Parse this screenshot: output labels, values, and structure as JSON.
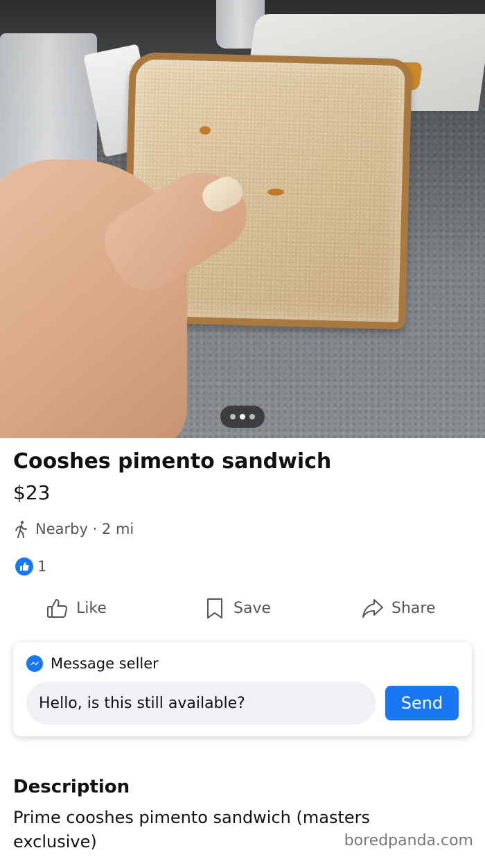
{
  "listing": {
    "title": "Cooshes pimento sandwich",
    "price": "$23",
    "location": "Nearby · 2 mi",
    "like_count": "1",
    "image_count": 3,
    "active_image": 2
  },
  "actions": {
    "like": "Like",
    "save": "Save",
    "share": "Share"
  },
  "message": {
    "header": "Message seller",
    "input_value": "Hello, is this still available?",
    "send": "Send"
  },
  "description": {
    "title": "Description",
    "text": "Prime cooshes pimento sandwich (masters exclusive)"
  },
  "watermark": "boredpanda.com",
  "colors": {
    "accent": "#1877f2",
    "muted_text": "#555555"
  },
  "icons": [
    "walk-icon",
    "like-icon",
    "thumb-up-icon",
    "bookmark-icon",
    "share-icon",
    "messenger-icon"
  ]
}
